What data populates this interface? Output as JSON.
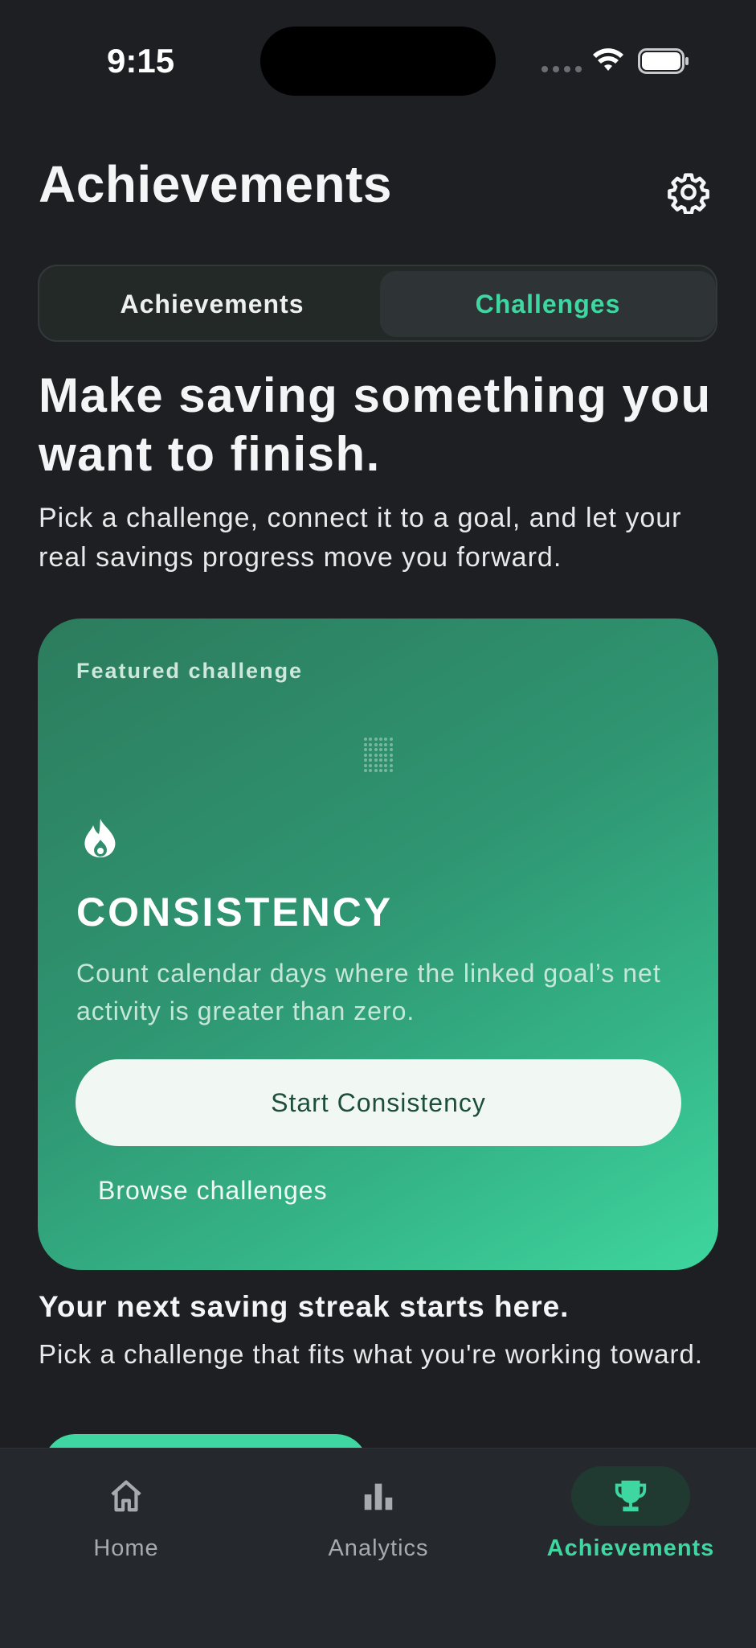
{
  "status_bar": {
    "time": "9:15"
  },
  "header": {
    "title": "Achievements",
    "settings_icon": "gear-icon"
  },
  "segmented_control": {
    "tabs": [
      {
        "label": "Achievements",
        "selected": false
      },
      {
        "label": "Challenges",
        "selected": true
      }
    ]
  },
  "hero": {
    "title": "Make saving something you want to finish.",
    "subtitle": "Pick a challenge, connect it to a goal, and let your real savings progress move you forward."
  },
  "featured": {
    "label": "Featured challenge",
    "icon": "flame-icon",
    "title": "CONSISTENCY",
    "description": "Count calendar days where the linked goal’s net activity is greater than zero.",
    "start_button": "Start Consistency",
    "browse_link": "Browse challenges"
  },
  "streak": {
    "title": "Your next saving streak starts here.",
    "subtitle": "Pick a challenge that fits what you're working toward."
  },
  "tab_bar": {
    "items": [
      {
        "label": "Home",
        "icon": "home-icon",
        "active": false
      },
      {
        "label": "Analytics",
        "icon": "bar-chart-icon",
        "active": false
      },
      {
        "label": "Achievements",
        "icon": "trophy-icon",
        "active": true
      }
    ]
  },
  "colors": {
    "background": "#1d1f22",
    "accent": "#3fd7a1",
    "card_gradient_start": "#2c7c5d",
    "card_gradient_end": "#3ed69e",
    "tab_bar": "#25282c"
  }
}
